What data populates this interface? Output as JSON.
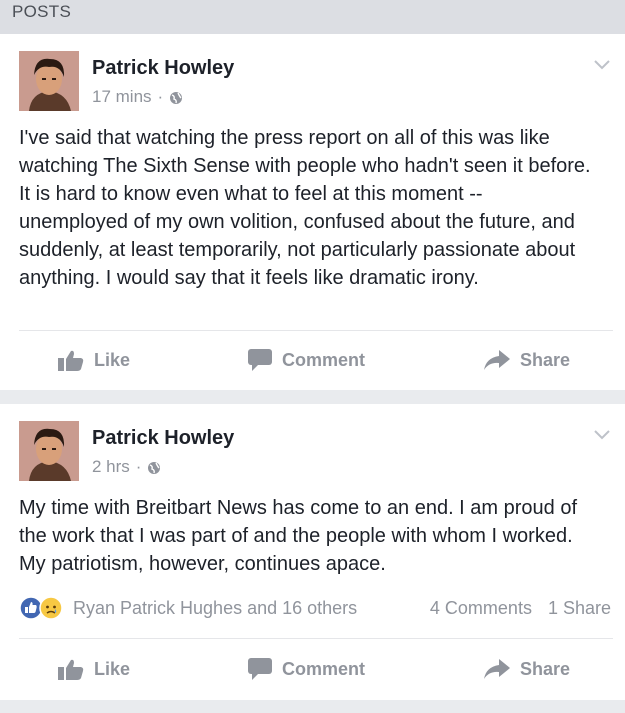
{
  "section": {
    "title": "POSTS"
  },
  "posts": [
    {
      "author": "Patrick Howley",
      "time": "17 mins",
      "separator": "·",
      "text": "I've said that watching the press report on all of this was like watching The Sixth Sense with people who hadn't seen it before. It is hard to know even what to feel at this moment -- unemployed of my own volition, confused about the future, and suddenly, at least temporarily, not particularly passionate about anything. I would say that it feels like dramatic irony.",
      "actions": {
        "like": "Like",
        "comment": "Comment",
        "share": "Share"
      }
    },
    {
      "author": "Patrick Howley",
      "time": "2 hrs",
      "separator": "·",
      "text": "My time with Breitbart News has come to an end. I am proud of the work that I was part of and the people with whom I worked. My patriotism, however, continues apace.",
      "reactions": {
        "names": "Ryan Patrick Hughes and 16 others",
        "comments": "4 Comments",
        "shares": "1 Share"
      },
      "actions": {
        "like": "Like",
        "comment": "Comment",
        "share": "Share"
      }
    }
  ],
  "colors": {
    "like_blue": "#4267b2",
    "sad_yellow": "#f7c843",
    "muted_text": "#90949c",
    "body_text": "#1d2129",
    "background": "#e9ebee"
  },
  "icons": [
    "globe-icon",
    "chevron-down-icon",
    "thumbs-up-icon",
    "comment-icon",
    "share-icon",
    "like-reaction-icon",
    "sad-reaction-icon"
  ]
}
